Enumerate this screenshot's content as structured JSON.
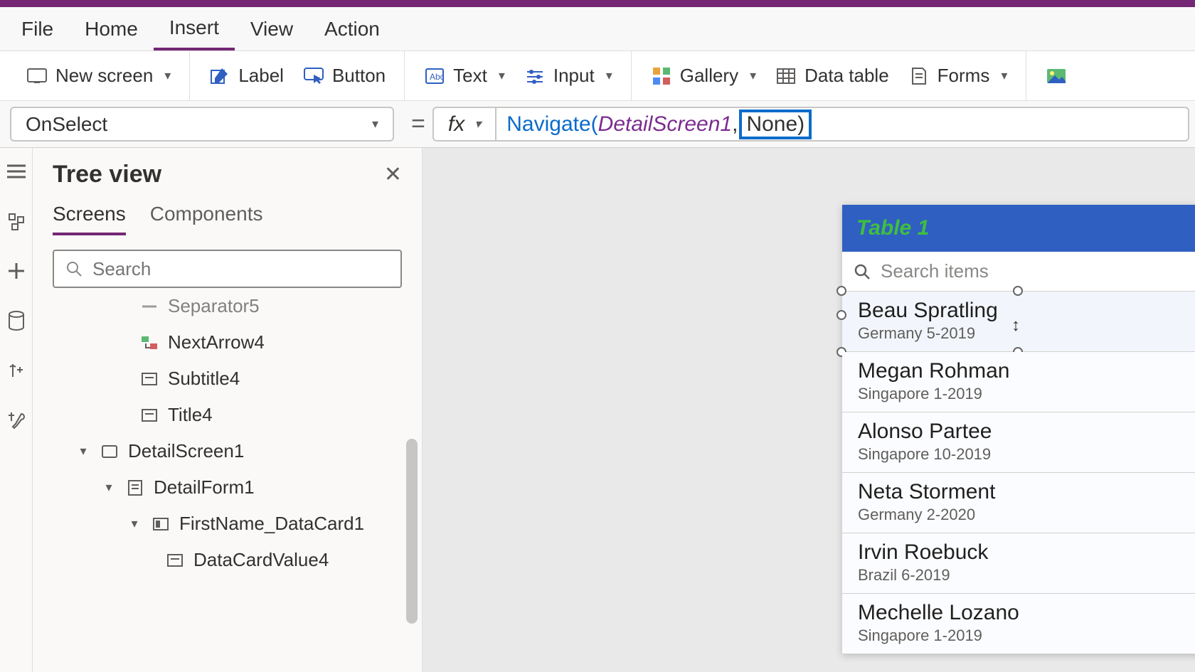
{
  "menu": {
    "file": "File",
    "home": "Home",
    "insert": "Insert",
    "view": "View",
    "action": "Action"
  },
  "ribbon": {
    "new_screen": "New screen",
    "label": "Label",
    "button": "Button",
    "text": "Text",
    "input": "Input",
    "gallery": "Gallery",
    "data_table": "Data table",
    "forms": "Forms"
  },
  "formula": {
    "property": "OnSelect",
    "fx": "fx",
    "func": "Navigate",
    "open": "(",
    "arg1": "DetailScreen1",
    "comma": ",",
    "arg2_sel": " None)",
    "equals": "="
  },
  "tree": {
    "title": "Tree view",
    "tab_screens": "Screens",
    "tab_components": "Components",
    "search_ph": "Search",
    "items": {
      "separator": "Separator5",
      "nextarrow": "NextArrow4",
      "subtitle": "Subtitle4",
      "title4": "Title4",
      "detailscreen": "DetailScreen1",
      "detailform": "DetailForm1",
      "datacard": "FirstName_DataCard1",
      "datacardvalue": "DataCardValue4"
    }
  },
  "app": {
    "title": "Table 1",
    "search_ph": "Search items",
    "rows": [
      {
        "name": "Beau Spratling",
        "sub": "Germany 5-2019"
      },
      {
        "name": "Megan Rohman",
        "sub": "Singapore 1-2019"
      },
      {
        "name": "Alonso Partee",
        "sub": "Singapore 10-2019"
      },
      {
        "name": "Neta Storment",
        "sub": "Germany 2-2020"
      },
      {
        "name": "Irvin Roebuck",
        "sub": "Brazil 6-2019"
      },
      {
        "name": "Mechelle Lozano",
        "sub": "Singapore 1-2019"
      }
    ]
  }
}
